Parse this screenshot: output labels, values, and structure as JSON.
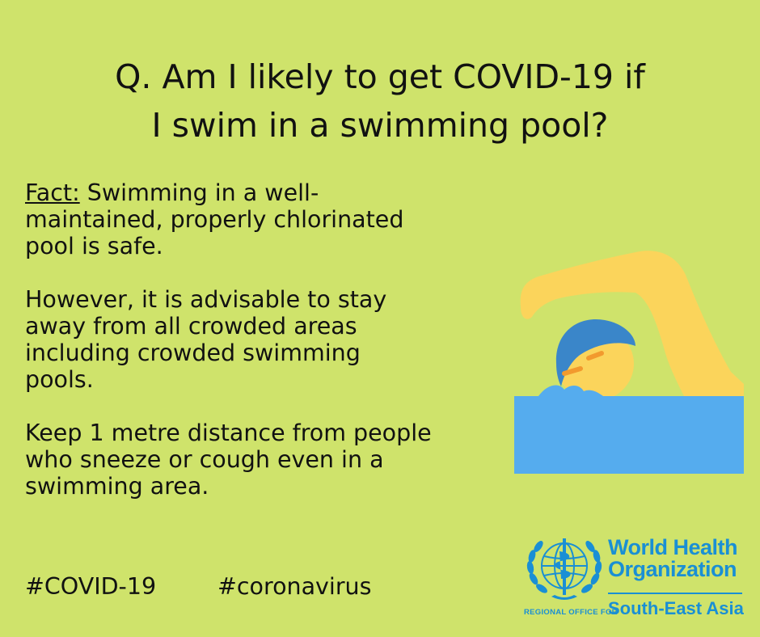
{
  "background_color": "#cfe36b",
  "question": {
    "line1": "Q.  Am I likely to get COVID-19 if",
    "line2": "I swim in a swimming pool?"
  },
  "fact": {
    "label": "Fact:",
    "line1": " Swimming in a well-",
    "line2": "maintained, properly chlorinated",
    "line3": "pool is safe."
  },
  "advice": {
    "line1": "However, it is advisable to stay",
    "line2": "away from all crowded areas",
    "line3": "including crowded swimming",
    "line4": "pools."
  },
  "distance": {
    "line1": "Keep 1 metre distance from people",
    "line2": "who sneeze or cough even in a",
    "line3": "swimming area."
  },
  "hashtags": {
    "tag1": "#COVID-19",
    "tag2": "#coronavirus"
  },
  "illustration": {
    "icon": "swimmer-icon",
    "skin_color": "#fbd45b",
    "cap_color": "#3a86c9",
    "water_color": "#55acee",
    "mouth_color": "#f29a2e"
  },
  "logo": {
    "icon": "who-emblem-icon",
    "name_line1": "World Health",
    "name_line2": "Organization",
    "regional_label": "REGIONAL OFFICE FOR",
    "region": "South-East Asia",
    "brand_color": "#1a8fd4"
  }
}
